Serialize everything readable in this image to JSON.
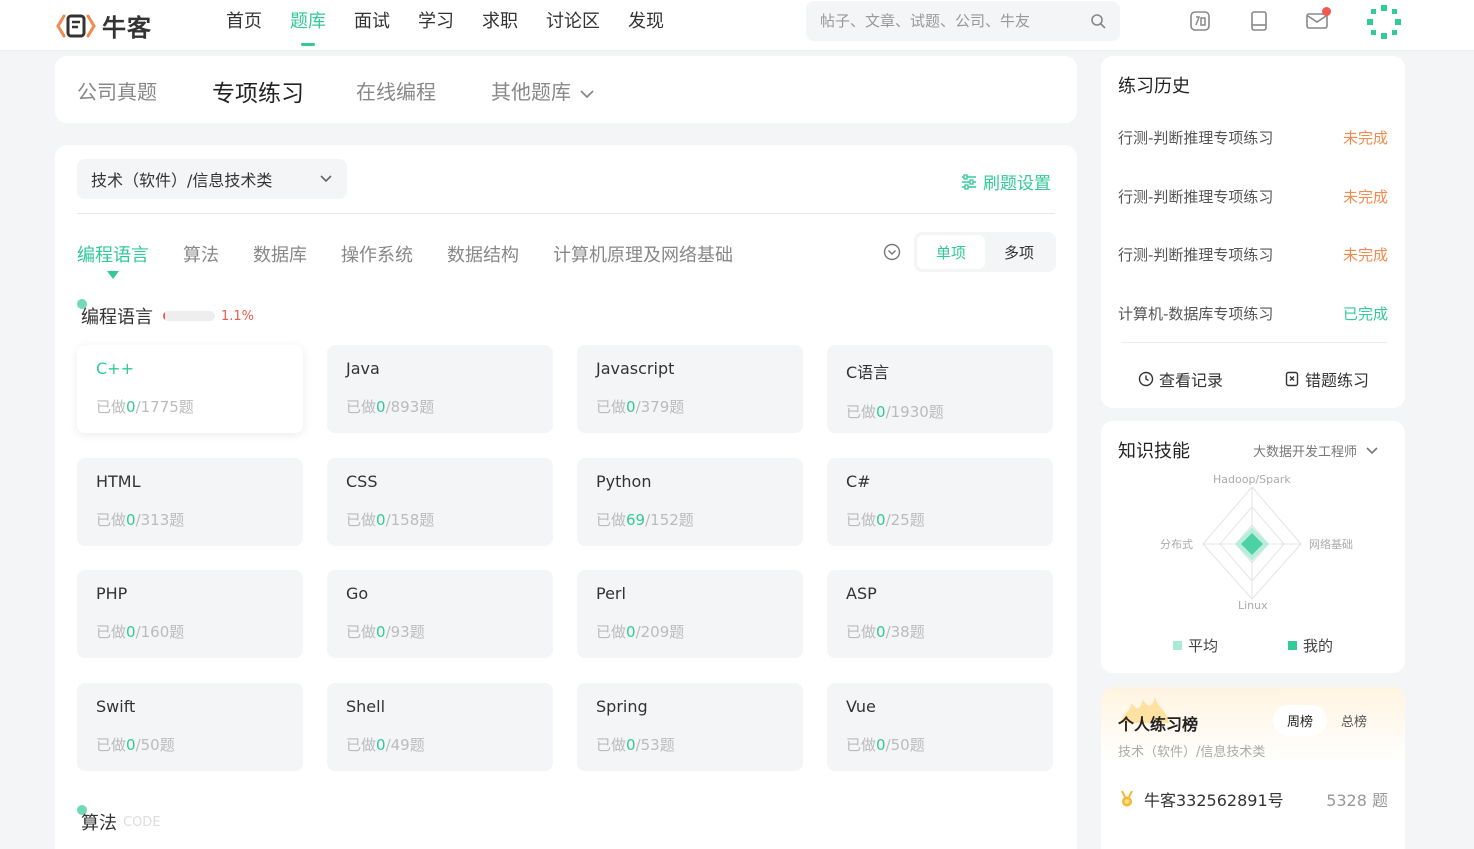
{
  "brand": {
    "name": "牛客",
    "accent": "#32ca99",
    "warn": "#f05a4e",
    "pending": "#f08a4e"
  },
  "nav": {
    "items": [
      "首页",
      "题库",
      "面试",
      "学习",
      "求职",
      "讨论区",
      "发现"
    ],
    "active_index": 1
  },
  "search": {
    "placeholder": "帖子、文章、试题、公司、牛友"
  },
  "top_icons": [
    "recruit-icon",
    "notebook-icon",
    "mail-icon",
    "avatar"
  ],
  "top_tabs": {
    "items": [
      "公司真题",
      "专项练习",
      "在线编程",
      "其他题库"
    ],
    "active_index": 1
  },
  "filter": {
    "category": "技术（软件）/信息技术类",
    "settings_label": "刷题设置"
  },
  "subtabs": {
    "items": [
      "编程语言",
      "算法",
      "数据库",
      "操作系统",
      "数据结构",
      "计算机原理及网络基础"
    ],
    "active_index": 0
  },
  "toggle": {
    "single": "单项",
    "multi": "多项",
    "active": "single"
  },
  "sections": [
    {
      "title": "编程语言",
      "progress_text": "1.1%",
      "progress_value": 1.1,
      "cards": [
        {
          "name": "C++",
          "done": "0",
          "total": "/1775题",
          "selected": true
        },
        {
          "name": "Java",
          "done": "0",
          "total": "/893题"
        },
        {
          "name": "Javascript",
          "done": "0",
          "total": "/379题"
        },
        {
          "name": "C语言",
          "done": "0",
          "total": "/1930题"
        },
        {
          "name": "HTML",
          "done": "0",
          "total": "/313题"
        },
        {
          "name": "CSS",
          "done": "0",
          "total": "/158题"
        },
        {
          "name": "Python",
          "done": "69",
          "total": "/152题"
        },
        {
          "name": "C#",
          "done": "0",
          "total": "/25题"
        },
        {
          "name": "PHP",
          "done": "0",
          "total": "/160题"
        },
        {
          "name": "Go",
          "done": "0",
          "total": "/93题"
        },
        {
          "name": "Perl",
          "done": "0",
          "total": "/209题"
        },
        {
          "name": "ASP",
          "done": "0",
          "total": "/38题"
        },
        {
          "name": "Swift",
          "done": "0",
          "total": "/50题"
        },
        {
          "name": "Shell",
          "done": "0",
          "total": "/49题"
        },
        {
          "name": "Spring",
          "done": "0",
          "total": "/53题"
        },
        {
          "name": "Vue",
          "done": "0",
          "total": "/50题"
        }
      ]
    },
    {
      "title": "算法",
      "ghost": "CODE"
    }
  ],
  "card_prefix": "已做",
  "history": {
    "title": "练习历史",
    "rows": [
      {
        "name": "行测-判断推理专项练习",
        "status": "未完成",
        "state": "pending"
      },
      {
        "name": "行测-判断推理专项练习",
        "status": "未完成",
        "state": "pending"
      },
      {
        "name": "行测-判断推理专项练习",
        "status": "未完成",
        "state": "pending"
      },
      {
        "name": "计算机-数据库专项练习",
        "status": "已完成",
        "state": "done"
      }
    ],
    "view_records": "查看记录",
    "wrong_practice": "错题练习"
  },
  "skills": {
    "title": "知识技能",
    "role": "大数据开发工程师",
    "axes": [
      "Hadoop/Spark",
      "网络基础",
      "Linux",
      "分布式"
    ],
    "legend_avg": "平均",
    "legend_mine": "我的"
  },
  "rank": {
    "title": "个人练习榜",
    "tab_week": "周榜",
    "tab_total": "总榜",
    "category": "技术（软件）/信息技术类",
    "first": {
      "user": "牛客332562891号",
      "score": "5328 题"
    }
  }
}
